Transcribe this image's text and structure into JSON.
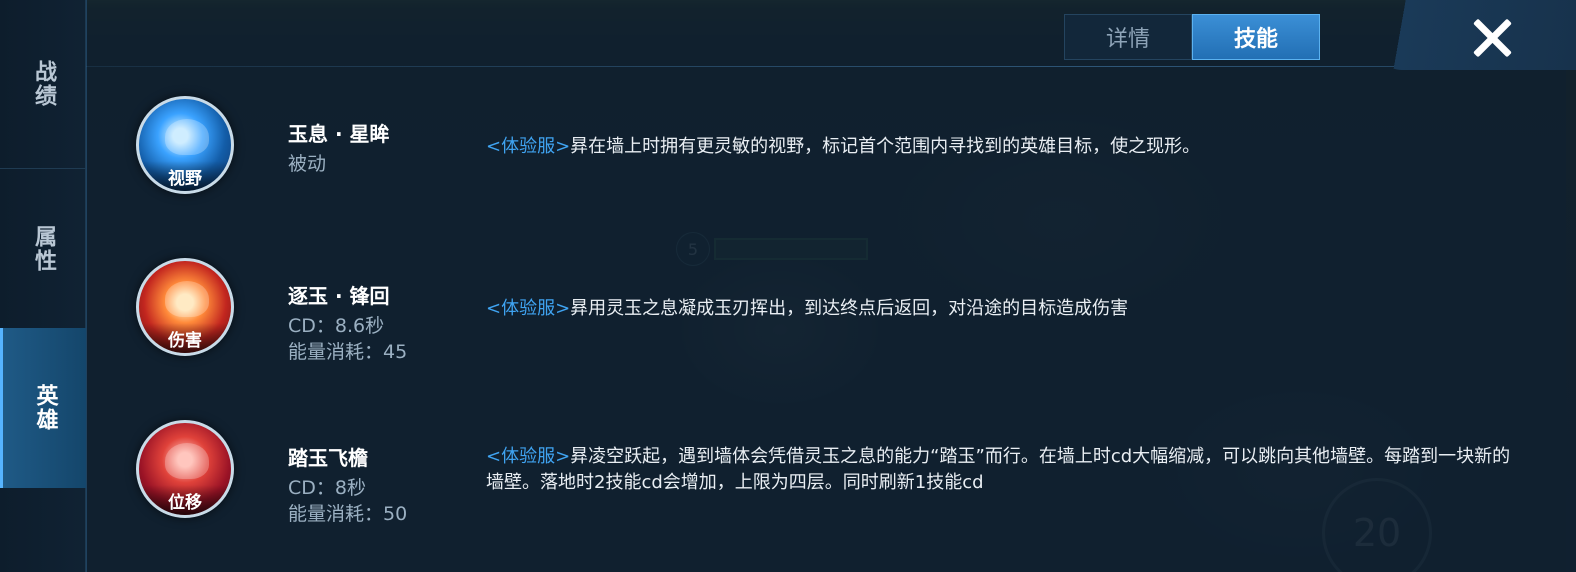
{
  "rail": {
    "tabs": [
      {
        "label": "战绩"
      },
      {
        "label": "属性"
      },
      {
        "label": "英雄"
      }
    ]
  },
  "top_tabs": [
    {
      "label": "详情",
      "active": false
    },
    {
      "label": "技能",
      "active": true
    }
  ],
  "skills": [
    {
      "icon": "passive-shark-icon",
      "tag": "视野",
      "name": "玉息 · 星眸",
      "sub1": "被动",
      "sub2": "",
      "server_tag": "<体验服>",
      "description": "昪在墙上时拥有更灵敏的视野，标记首个范围内寻找到的英雄目标，使之现形。"
    },
    {
      "icon": "jade-blade-icon",
      "tag": "伤害",
      "name": "逐玉 · 锋回",
      "sub1": "CD：8.6秒",
      "sub2": "能量消耗：45",
      "server_tag": "<体验服>",
      "description": "昪用灵玉之息凝成玉刃挥出，到达终点后返回，对沿途的目标造成伤害"
    },
    {
      "icon": "leap-figure-icon",
      "tag": "位移",
      "name": "踏玉飞檐",
      "sub1": "CD：8秒",
      "sub2": "能量消耗：50",
      "server_tag": "<体验服>",
      "description": "昪凌空跃起，遇到墙体会凭借灵玉之息的能力“踏玉”而行。在墙上时cd大幅缩减，可以跳向其他墙壁。每踏到一块新的墙壁。落地时2技能cd会增加，上限为四层。同时刷新1技能cd"
    }
  ],
  "hud": {
    "level": "5",
    "cooldown": "20"
  },
  "colors": {
    "accent": "#3fa3f1",
    "active_tab": "#2f82c9",
    "panel_bg": "#102030"
  }
}
